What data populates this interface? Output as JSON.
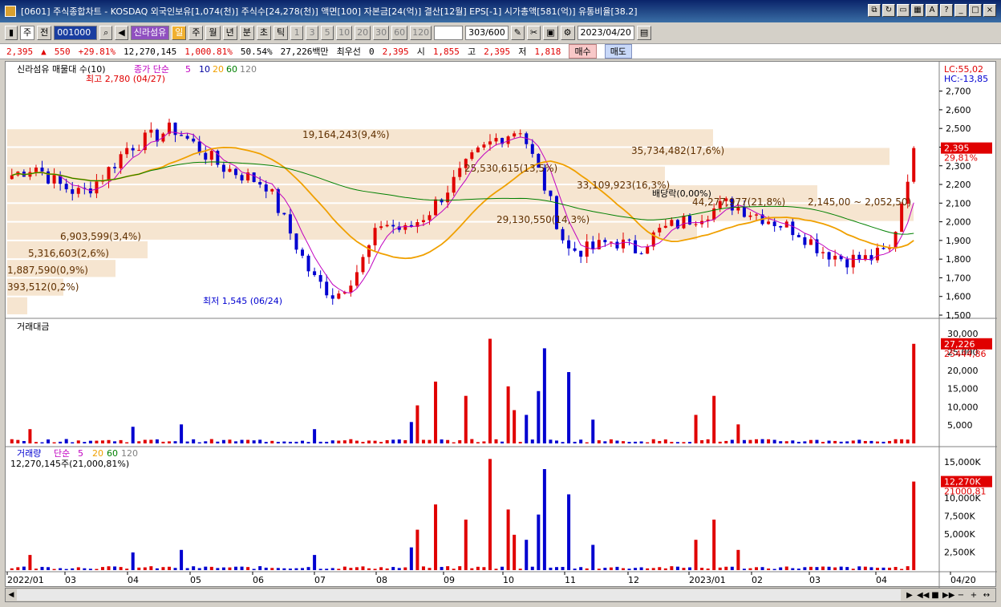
{
  "window": {
    "title": "[0601] 주식종합차트 - KOSDAQ 외국인보유[1,074(천)] 주식수[24,278(천)] 액면[100] 자본금[24(억)] 결산[12월] EPS[-1] 시가총액[581(억)] 유통비율[38.2]"
  },
  "toolbar": {
    "mode": "주",
    "jeon": "전",
    "code": "001000",
    "stock_name": "신라섬유",
    "periods": [
      "일",
      "주",
      "월",
      "년",
      "분",
      "초",
      "틱"
    ],
    "intervals": [
      "1",
      "3",
      "5",
      "10",
      "20",
      "30",
      "60",
      "120"
    ],
    "count": "303",
    "count_max": "/600",
    "date": "2023/04/20"
  },
  "quote": {
    "price": "2,395",
    "change": "550",
    "change_pct": "+29.81%",
    "volume": "12,270,145",
    "volume_pct": "1,000.81%",
    "ratio": "50.54%",
    "amount": "27,226백만",
    "best_ask_label": "최우선",
    "best_ask": "0",
    "best_ask_price": "2,395",
    "open_label": "시",
    "open": "1,855",
    "high_label": "고",
    "high": "2,395",
    "low_label": "저",
    "low": "1,818",
    "buy_label": "매수",
    "sell_label": "매도"
  },
  "price_panel": {
    "legend_title": "신라섬유 매물대 수(10)",
    "legend_ma_label": "종가 단순",
    "legend_ma": [
      "5",
      "10",
      "20",
      "60",
      "120"
    ],
    "lc": "LC:55,02",
    "hc": "HC:-13,85",
    "high_marker": "최고 2,780 (04/27)",
    "low_marker": "최저 1,545 (06/24)",
    "dividend_marker": "배당락(0,00%)",
    "current_price_tag": "2,395",
    "current_pct_tag": "29,81%",
    "y_ticks": [
      "2,700",
      "2,600",
      "2,500",
      "2,400",
      "2,300",
      "2,200",
      "2,100",
      "2,000",
      "1,900",
      "1,800",
      "1,700",
      "1,600",
      "1,500"
    ],
    "volume_profile": [
      "19,164,243(9,4%)",
      "35,734,482(17,6%)",
      "25,530,615(13,5%)",
      "33,109,923(16,3%)",
      "44,277,977(21,8%)",
      "29,130,550(14,3%)",
      "6,903,599(3,4%)",
      "5,316,603(2,6%)",
      "1,887,590(0,9%)",
      "393,512(0,2%)"
    ],
    "range_note": "2,145,00 ~ 2,052,50)"
  },
  "amount_panel": {
    "title": "거래대금",
    "y_ticks": [
      "30,000",
      "25,000",
      "20,000",
      "15,000",
      "10,000",
      "5,000"
    ],
    "current_tag": "27,226",
    "ma_tag": "25444,86"
  },
  "volume_panel": {
    "title": "거래량",
    "legend_label": "단순",
    "legend_ma": [
      "5",
      "20",
      "60",
      "120"
    ],
    "sub_label": "12,270,145주(21,000,81%)",
    "y_ticks": [
      "15,000K",
      "12,500K",
      "10,000K",
      "7,500K",
      "5,000K",
      "2,500K"
    ],
    "current_tag": "12,270K",
    "pct_tag": "21000,81"
  },
  "x_axis": [
    "2022/01",
    "03",
    "04",
    "05",
    "06",
    "07",
    "08",
    "09",
    "10",
    "11",
    "12",
    "2023/01",
    "02",
    "03",
    "04",
    "04/20"
  ],
  "chart_data": {
    "type": "candlestick",
    "title": "신라섬유 매물대 수(10)",
    "ylim_price": [
      1500,
      2780
    ],
    "price_high": 2780,
    "price_low": 1545,
    "last_close": 2395,
    "closes_approx": [
      2250,
      2300,
      2200,
      2150,
      2250,
      2400,
      2450,
      2500,
      2400,
      2300,
      2250,
      2200,
      1950,
      1700,
      1600,
      1750,
      2000,
      1950,
      2050,
      2200,
      2350,
      2450,
      2500,
      2200,
      1850,
      1850,
      1900,
      1850,
      1950,
      2000,
      2050,
      2100,
      2050,
      2000,
      1950,
      1850,
      1800,
      1800,
      1850,
      2395
    ],
    "colors": {
      "up": "#e00000",
      "down": "#0000d0",
      "ma5": "#c000c0",
      "ma10": "#0000a0",
      "ma20": "#f0a000",
      "ma60": "#008000",
      "ma120": "#808080"
    }
  }
}
